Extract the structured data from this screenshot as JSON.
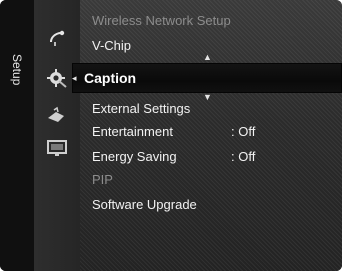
{
  "side_tab": {
    "label": "Setup"
  },
  "menu": {
    "items_top": [
      {
        "label": "Wireless Network Setup",
        "dim": true
      },
      {
        "label": "V-Chip",
        "dim": false
      }
    ],
    "selected": {
      "label": "Caption"
    },
    "items_bottom": [
      {
        "label": "External Settings",
        "value": "",
        "dim": false
      },
      {
        "label": "Entertainment",
        "value": ": Off",
        "dim": false
      },
      {
        "label": "Energy Saving",
        "value": ": Off",
        "dim": false
      },
      {
        "label": "PIP",
        "value": "",
        "dim": true
      },
      {
        "label": "Software Upgrade",
        "value": "",
        "dim": false
      }
    ]
  },
  "icons": {
    "icon_1": "satellite-dish-icon",
    "icon_2_selected": "gear-icon",
    "icon_3": "input-icon",
    "icon_4": "monitor-icon"
  },
  "arrows": {
    "up": "▲",
    "down": "▼",
    "selected_left": "◂"
  },
  "colors": {
    "background": "#2b2b2b",
    "text": "#f2f2f2",
    "dim_text": "#8c8c8c",
    "highlight": "#0f0f0f"
  }
}
